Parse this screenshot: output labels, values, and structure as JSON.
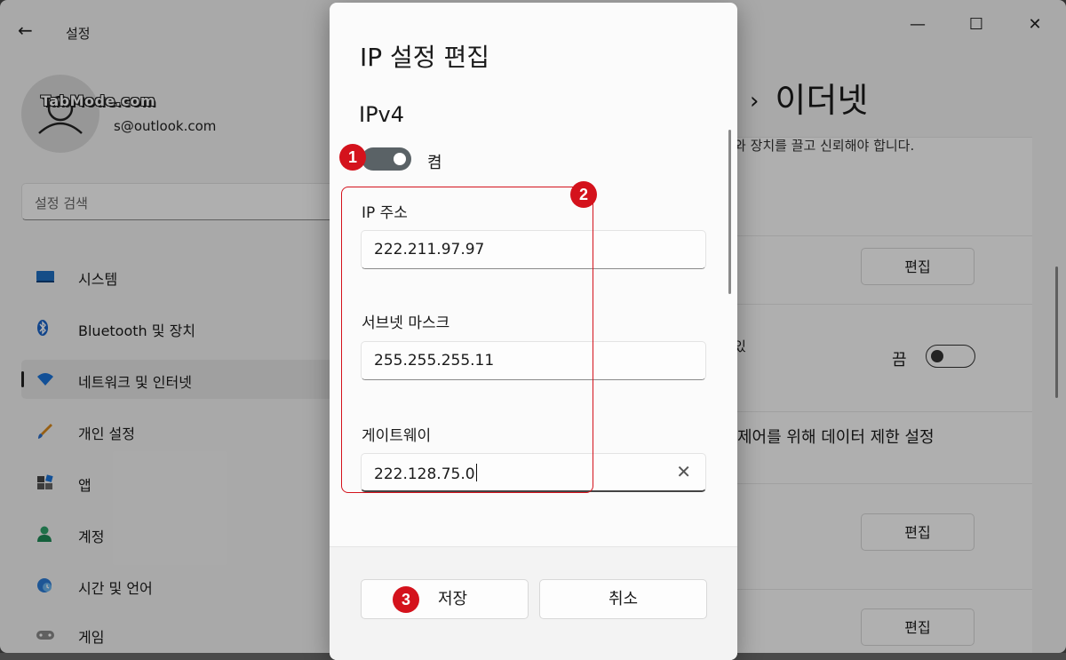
{
  "window": {
    "title": "설정",
    "back_glyph": "←",
    "controls": {
      "minimize": "—",
      "maximize": "☐",
      "close": "✕"
    }
  },
  "user": {
    "watermark": "TabMode.com",
    "email": "s@outlook.com"
  },
  "search": {
    "placeholder": "설정 검색"
  },
  "sidebar": {
    "items": [
      {
        "label": "시스템",
        "icon": "monitor-icon"
      },
      {
        "label": "Bluetooth 및 장치",
        "icon": "bluetooth-icon"
      },
      {
        "label": "네트워크 및 인터넷",
        "icon": "wifi-icon",
        "active": true
      },
      {
        "label": "개인 설정",
        "icon": "brush-icon"
      },
      {
        "label": "앱",
        "icon": "apps-icon"
      },
      {
        "label": "계정",
        "icon": "person-icon"
      },
      {
        "label": "시간 및 언어",
        "icon": "globe-clock-icon"
      },
      {
        "label": "게임",
        "icon": "gamepad-icon"
      }
    ]
  },
  "page": {
    "breadcrumb_sep": "›",
    "title": "이더넷",
    "partial_text_top": "와 장치를 끌고 신뢰해야 합니다.",
    "partial_text_mid": "있",
    "metered_text": "제어를 위해 데이터 제한 설정",
    "toggle_state": "끔",
    "edit_label": "편집"
  },
  "dialog": {
    "title": "IP 설정 편집",
    "section": "IPv4",
    "toggle_label": "켬",
    "fields": {
      "ip": {
        "label": "IP 주소",
        "value": "222.211.97.97"
      },
      "mask": {
        "label": "서브넷 마스크",
        "value": "255.255.255.11"
      },
      "gateway": {
        "label": "게이트웨이",
        "value": "222.128.75.0"
      }
    },
    "clear_glyph": "✕",
    "save_label": "저장",
    "cancel_label": "취소"
  },
  "annotations": {
    "one": "1",
    "two": "2",
    "three": "3"
  },
  "colors": {
    "accent_red": "#d4121c",
    "toggle_on": "#5a6266"
  }
}
